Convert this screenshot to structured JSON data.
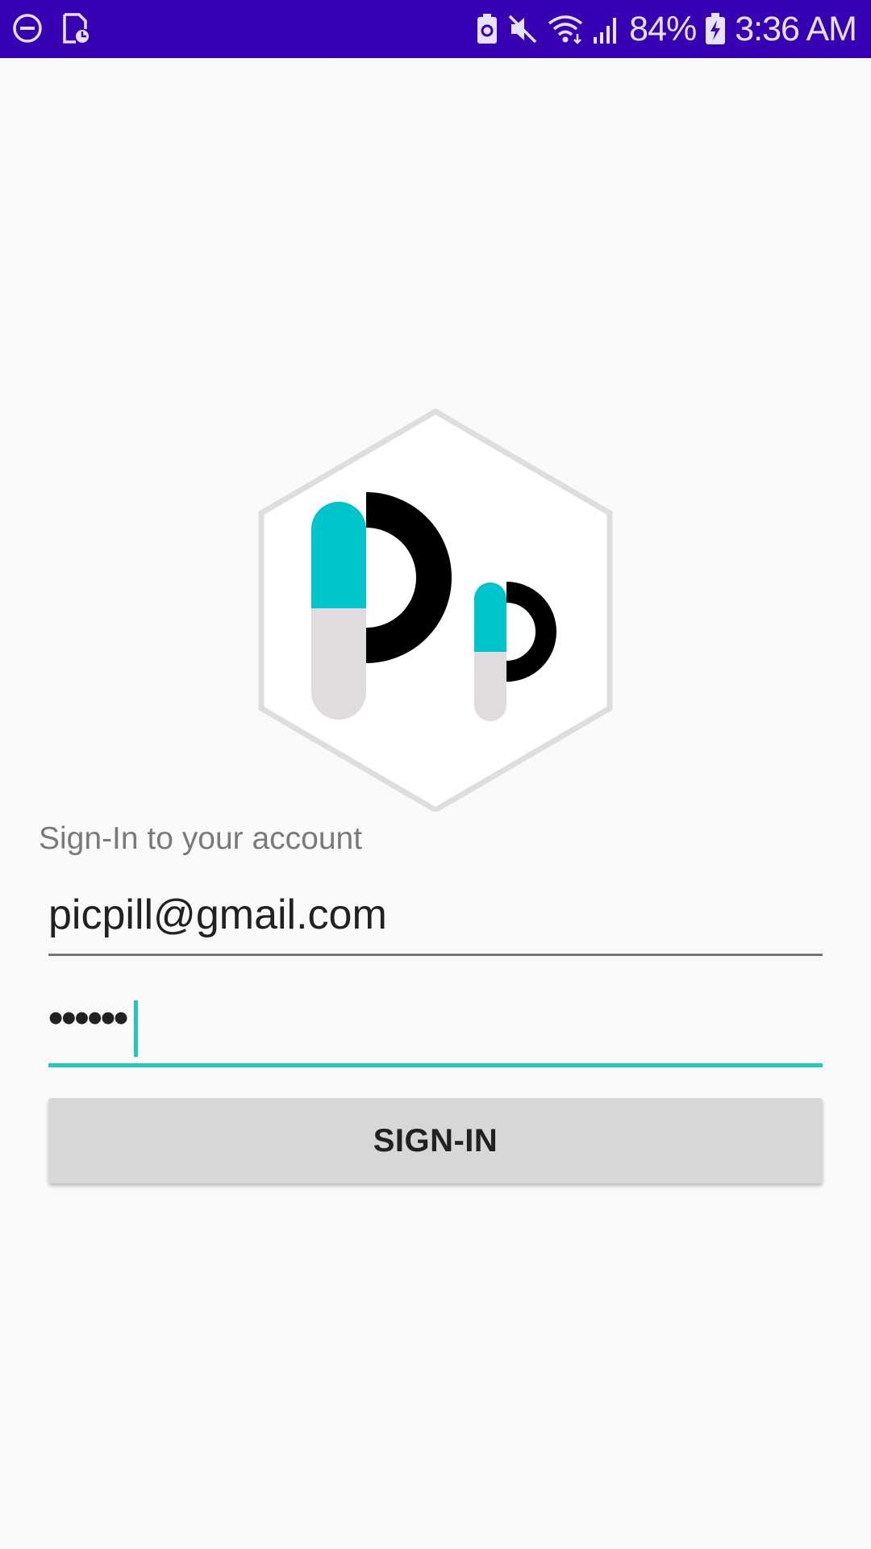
{
  "status_bar": {
    "battery_percent": "84%",
    "time": "3:36 AM",
    "background": "#3800b3",
    "left_icons": [
      "do-not-disturb-icon",
      "screenshot-file-icon"
    ],
    "right_icons": [
      "recycle-battery-icon",
      "mute-icon",
      "wifi-icon",
      "signal-icon",
      "battery-charging-icon"
    ]
  },
  "logo": {
    "icon": "picpill-logo",
    "colors": {
      "capsule_top": "#00c4cc",
      "capsule_bottom": "#e0dce0",
      "letter": "#000000",
      "hexagon_border": "#e1dce1"
    }
  },
  "form": {
    "subtitle": "Sign-In to your account",
    "email_value": "picpill@gmail.com",
    "password_mask": "••••••",
    "submit_label": "SIGN-IN",
    "accent_color": "#1fc9bd"
  }
}
